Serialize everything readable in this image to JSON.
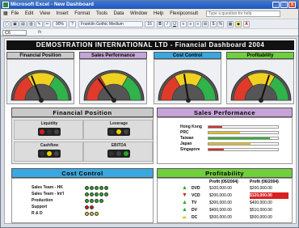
{
  "window": {
    "title": "Microsoft Excel - New Dashboard",
    "buttons": [
      "_",
      "□",
      "x"
    ]
  },
  "menu": {
    "items": [
      "File",
      "Edit",
      "View",
      "Insert",
      "Format",
      "Tools",
      "Data",
      "Window",
      "Help",
      "Flexipconsult"
    ],
    "help_placeholder": "Type a question for help"
  },
  "toolbar": {
    "zoom": "90%",
    "font": "Franklin Gothic Medium",
    "font_size": "16",
    "bold": "B",
    "italic": "I",
    "underline": "U",
    "currency": "$",
    "percent": "%"
  },
  "formula": {
    "name_box": "C6",
    "fx": "fx"
  },
  "dashboard": {
    "title": "DEMOSTRATION INTERNATIONAL LTD - Financial Dashboard 2004",
    "gauges": [
      {
        "title": "Financial Position",
        "color": "#c9c9c9",
        "level": 0.38
      },
      {
        "title": "Sales Performance",
        "color": "#c6a3d8",
        "level": 0.3
      },
      {
        "title": "Cost Control",
        "color": "#3ba7e0",
        "level": 0.45
      },
      {
        "title": "Profitability",
        "color": "#6fcf3c",
        "level": 0.6
      }
    ],
    "financial_position": {
      "title": "Financial Position",
      "items": [
        {
          "label": "Liquidity",
          "lights": [
            "#cc2222",
            "#333333",
            "#444444"
          ]
        },
        {
          "label": "Leverage",
          "lights": [
            "#333333",
            "#f0d000",
            "#444444"
          ]
        },
        {
          "label": "Cashflow",
          "lights": [
            "#333333",
            "#f0d000",
            "#444444"
          ]
        },
        {
          "label": "EBITDA",
          "lights": [
            "#333333",
            "#444444",
            "#22aa22"
          ]
        }
      ]
    },
    "sales_performance": {
      "title": "Sales Performance",
      "rows": [
        {
          "label": "Hong Kong",
          "fill": 0.2,
          "color": "#d03030"
        },
        {
          "label": "PRC",
          "fill": 0.45,
          "color": "#e0c020"
        },
        {
          "label": "Taiwan",
          "fill": 0.88,
          "color": "#30b030"
        },
        {
          "label": "Japan",
          "fill": 0.6,
          "color": "#e0c020"
        },
        {
          "label": "Singapore",
          "fill": 0.22,
          "color": "#d03030"
        }
      ]
    },
    "cost_control": {
      "title": "Cost Control",
      "rows": [
        {
          "label": "Sales Team - HK",
          "dots": [
            "#22aa22",
            "#22aa22",
            "#22aa22",
            "#22aa22",
            "#22aa22"
          ]
        },
        {
          "label": "Sales Team - Int'l",
          "dots": [
            "#22aa22",
            "#22aa22",
            "#22aa22",
            "#22aa22",
            "#22aa22"
          ]
        },
        {
          "label": "Production",
          "dots": [
            "#22aa22",
            "#22aa22",
            "#22aa22",
            "#22aa22"
          ]
        },
        {
          "label": "Support",
          "dots": [
            "#cc2222",
            "#cc2222"
          ]
        },
        {
          "label": "R & D",
          "dots": [
            "#e0c020",
            "#e0c020",
            "#e0c020"
          ]
        }
      ]
    },
    "profitability": {
      "title": "Profitability",
      "headers": [
        "Profit (05/2004)",
        "Profit (06/2004)"
      ],
      "rows": [
        {
          "arrow": "▲",
          "arrow_color": "#22aa22",
          "code": "DVD",
          "v1": "$100,000.00",
          "v2": "$200,000.00",
          "highlight": false
        },
        {
          "arrow": "▼",
          "arrow_color": "#cc2222",
          "code": "VCD",
          "v1": "$200,000.00",
          "v2": "$120,000.00",
          "highlight": true
        },
        {
          "arrow": "▲",
          "arrow_color": "#22aa22",
          "code": "TV",
          "v1": "$300,000.00",
          "v2": "$400,000.00",
          "highlight": false
        },
        {
          "arrow": "▲",
          "arrow_color": "#22aa22",
          "code": "DV",
          "v1": "$400,000.00",
          "v2": "$510,000.00",
          "highlight": false
        },
        {
          "arrow": "◀▶",
          "arrow_color": "#e0c020",
          "code": "DC",
          "v1": "$500,000.00",
          "v2": "$500,000.00",
          "highlight": false
        }
      ]
    }
  }
}
